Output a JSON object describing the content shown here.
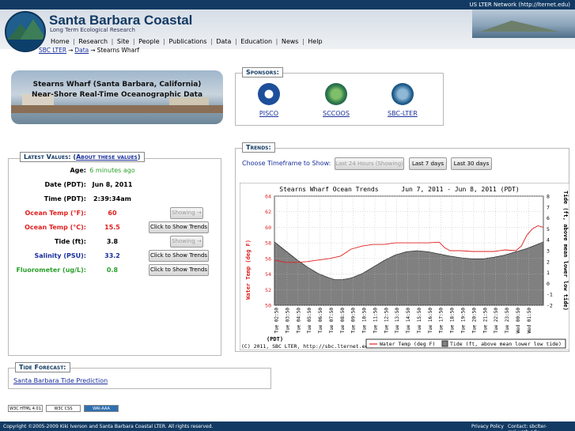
{
  "topbar": {
    "network_link": "US LTER Network (http://lternet.edu)"
  },
  "header": {
    "title": "Santa Barbara Coastal",
    "subtitle": "Long Term Ecological Research"
  },
  "nav": {
    "items": [
      "Home",
      "Research",
      "Site",
      "People",
      "Publications",
      "Data",
      "Education",
      "News",
      "Help"
    ],
    "separator": "|"
  },
  "breadcrumb": {
    "items": [
      "SBC LTER",
      "Data",
      "Stearns Wharf"
    ],
    "arrow": "→"
  },
  "banner": {
    "line1": "Stearns Wharf (Santa Barbara, California)",
    "line2": "Near-Shore Real-Time Oceanographic Data"
  },
  "sponsors": {
    "heading": "Sponsors:",
    "items": [
      {
        "label": "PISCO",
        "icon": "pisco-logo-icon",
        "color": "#1d4f9a"
      },
      {
        "label": "SCCOOS",
        "icon": "sccoos-logo-icon",
        "color": "#2f7d4b"
      },
      {
        "label": "SBC-LTER",
        "icon": "sbc-lter-logo-icon",
        "color": "#1f5e8d"
      }
    ]
  },
  "latest": {
    "heading": "Latest Values:",
    "paren_open": "(",
    "paren_close": ")",
    "about_link": "About these values",
    "rows": [
      {
        "label": "Age:",
        "value": "6 minutes ago",
        "label_color": "#000000",
        "value_color": "#2ca02c"
      },
      {
        "label": "Date (PDT):",
        "value": "Jun 8, 2011",
        "label_color": "#000000",
        "value_color": "#000000"
      },
      {
        "label": "Time (PDT):",
        "value": "2:39:34am",
        "label_color": "#000000",
        "value_color": "#000000"
      },
      {
        "label": "Ocean Temp (°F):",
        "value": "60",
        "label_color": "#e02020",
        "value_color": "#e02020",
        "button": "Showing →",
        "button_disabled": true
      },
      {
        "label": "Ocean Temp (°C):",
        "value": "15.5",
        "label_color": "#e02020",
        "value_color": "#e02020",
        "button": "Click to Show Trends",
        "button_disabled": false
      },
      {
        "label": "Tide (ft):",
        "value": "3.8",
        "label_color": "#000000",
        "value_color": "#000000",
        "button": "Showing →",
        "button_disabled": true
      },
      {
        "label": "Salinity (PSU):",
        "value": "33.2",
        "label_color": "#1a2f9c",
        "value_color": "#1a2f9c",
        "button": "Click to Show Trends",
        "button_disabled": false
      },
      {
        "label": "Fluorometer (ug/L):",
        "value": "0.8",
        "label_color": "#2ca02c",
        "value_color": "#2ca02c",
        "button": "Click to Show Trends",
        "button_disabled": false
      }
    ]
  },
  "trends": {
    "heading": "Trends:",
    "timeframe_label": "Choose Timeframe to Show:",
    "buttons": [
      {
        "label": "Last 24 Hours (Showing)",
        "disabled": true
      },
      {
        "label": "Last 7 days",
        "disabled": false
      },
      {
        "label": "Last 30 days",
        "disabled": false
      }
    ]
  },
  "chart_data": {
    "type": "line",
    "title": "Stearns Wharf Ocean Trends      Jun 7, 2011 - Jun 8, 2011 (PDT)",
    "ylabel_left": "Water Temp (deg F)",
    "ylabel_right": "Tide (ft, above mean lower low tide)",
    "xlabel": "(PDT)",
    "credit": "(C) 2011, SBC LTER, http://sbc.lternet.edu/",
    "ylim_left": [
      50,
      64
    ],
    "ylim_right": [
      -2,
      8
    ],
    "yticks_left": [
      50,
      52,
      54,
      56,
      58,
      60,
      62,
      64
    ],
    "yticks_right": [
      -2,
      -1,
      0,
      1,
      2,
      3,
      4,
      5,
      6,
      7,
      8
    ],
    "xlim": [
      0,
      24.5
    ],
    "x_tick_labels": [
      "Tue 02:50",
      "Tue 03:50",
      "Tue 04:50",
      "Tue 05:50",
      "Tue 06:50",
      "Tue 07:50",
      "Tue 08:50",
      "Tue 09:50",
      "Tue 10:50",
      "Tue 11:50",
      "Tue 12:50",
      "Tue 13:50",
      "Tue 14:50",
      "Tue 15:50",
      "Tue 16:50",
      "Tue 17:50",
      "Tue 18:50",
      "Tue 19:50",
      "Tue 20:50",
      "Tue 21:50",
      "Tue 22:50",
      "Tue 23:50",
      "Wed 00:50",
      "Wed 01:50"
    ],
    "series": [
      {
        "name": "Water Temp (deg F)",
        "color": "#e02020",
        "axis": "left",
        "x": [
          0,
          1,
          2,
          3,
          4,
          5,
          6,
          7,
          8,
          9,
          10,
          11,
          12,
          13,
          14,
          15,
          15.5,
          16,
          17,
          18,
          19,
          20,
          21,
          22,
          22.5,
          23,
          23.5,
          24,
          24.5
        ],
        "y": [
          55.8,
          55.5,
          55.5,
          55.6,
          55.8,
          56.0,
          56.3,
          57.2,
          57.6,
          57.8,
          57.8,
          58.0,
          58.0,
          58.0,
          58.0,
          58.1,
          57.4,
          57.0,
          57.0,
          56.9,
          56.9,
          56.9,
          57.1,
          57.0,
          57.6,
          59.0,
          59.8,
          60.2,
          60.0
        ]
      },
      {
        "name": "Tide (ft, above mean lower low tide)",
        "color": "#808080",
        "axis": "right",
        "x": [
          0,
          1,
          2,
          3,
          4,
          5,
          5.5,
          6,
          6.5,
          7,
          8,
          9,
          10,
          11,
          12,
          13,
          14,
          15,
          16,
          17,
          18,
          19,
          20,
          21,
          22,
          23,
          24,
          24.5
        ],
        "y": [
          3.8,
          3.0,
          2.2,
          1.5,
          0.9,
          0.5,
          0.35,
          0.35,
          0.4,
          0.5,
          0.9,
          1.5,
          2.1,
          2.6,
          2.9,
          3.0,
          2.9,
          2.7,
          2.5,
          2.35,
          2.25,
          2.25,
          2.4,
          2.6,
          2.9,
          3.2,
          3.6,
          3.8
        ]
      }
    ],
    "legend": [
      "Water Temp (deg F)",
      "Tide (ft, above mean lower low tide)"
    ]
  },
  "tide_forecast": {
    "heading": "Tide Forecast:",
    "link": "Santa Barbara Tide Prediction"
  },
  "badges": [
    {
      "text": "W3C HTML 4.01",
      "color": "#f2c14e"
    },
    {
      "text": "W3C CSS",
      "color": "#f2c14e"
    },
    {
      "text": "WAI-AAA",
      "color": "#2f6fb0"
    }
  ],
  "footer": {
    "copyright": "Copyright ©2005-2009 Kiki Iverson and Santa Barbara Coastal LTER. All rights reserved.",
    "privacy": "Privacy Policy",
    "contact": "Contact: sbclter-msi.ucsb.edu"
  }
}
